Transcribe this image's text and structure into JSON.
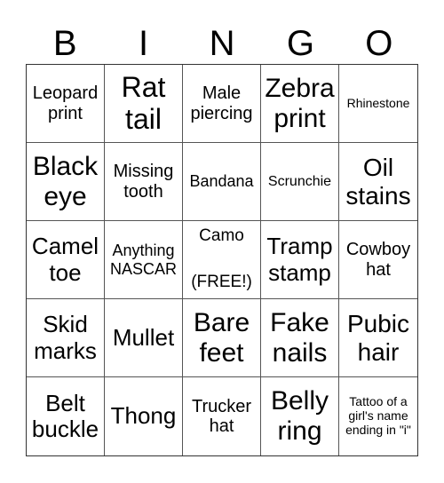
{
  "header": {
    "letters": [
      "B",
      "I",
      "N",
      "G",
      "O"
    ]
  },
  "cells": [
    "Leopard print",
    "Rat tail",
    "Male piercing",
    "Zebra print",
    "Rhinestone",
    "Black eye",
    "Missing tooth",
    "Bandana",
    "Scrunchie",
    "Oil stains",
    "Camel toe",
    "Anything NASCAR",
    "Camo",
    "Tramp stamp",
    "Cowboy hat",
    "Skid marks",
    "Mullet",
    "Bare feet",
    "Fake nails",
    "Pubic hair",
    "Belt buckle",
    "Thong",
    "Trucker hat",
    "Belly ring",
    "Tattoo of a girl's name ending in \"i\""
  ],
  "free_space": {
    "label": "Camo",
    "free_label": "(FREE!)"
  }
}
